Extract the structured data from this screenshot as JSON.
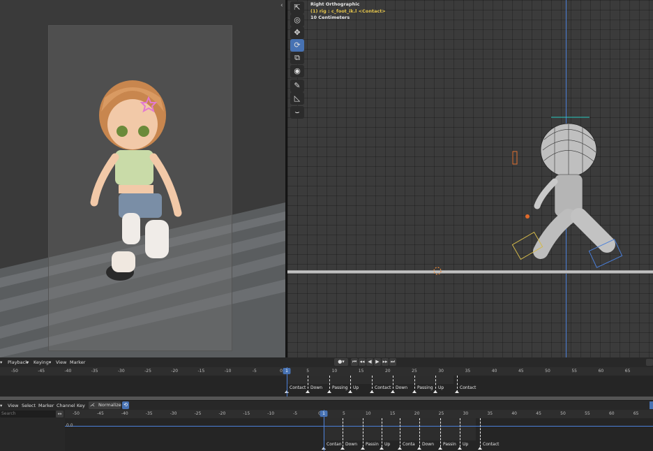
{
  "viewport_right": {
    "view_name": "Right Orthographic",
    "object_line": "(1) rig : c_foot_ik.l <Contact>",
    "scale_text": "10 Centimeters"
  },
  "toolbar": {
    "tools": [
      {
        "name": "select-tool",
        "glyph": "⇱",
        "active": false
      },
      {
        "name": "cursor-tool",
        "glyph": "◎",
        "active": false
      },
      {
        "name": "move-tool",
        "glyph": "✥",
        "active": false
      },
      {
        "name": "rotate-tool",
        "glyph": "⟳",
        "active": true
      },
      {
        "name": "scale-tool",
        "glyph": "⧉",
        "active": false
      },
      {
        "name": "transform-tool",
        "glyph": "◉",
        "active": false
      },
      {
        "name": "annotate-tool",
        "glyph": "✎",
        "active": false
      },
      {
        "name": "measure-tool",
        "glyph": "◺",
        "active": false
      },
      {
        "name": "pose-tool",
        "glyph": "⌣",
        "active": false
      }
    ]
  },
  "timeline": {
    "menu": {
      "playback": "Playback",
      "keying": "Keying",
      "view": "View",
      "marker": "Marker"
    },
    "current_frame": "1",
    "ticks": [
      "-50",
      "-45",
      "-40",
      "-35",
      "-30",
      "-25",
      "-20",
      "-15",
      "-10",
      "-5",
      "0",
      "5",
      "10",
      "15",
      "20",
      "25",
      "30",
      "35",
      "40",
      "45",
      "50",
      "55",
      "60",
      "65"
    ],
    "markers": [
      "Contact",
      "Down",
      "Passing",
      "Up",
      "Contact",
      "Down",
      "Passing",
      "Up",
      "Contact"
    ]
  },
  "graph_editor": {
    "menu": {
      "view": "View",
      "select": "Select",
      "marker": "Marker",
      "channel": "Channel",
      "key": "Key",
      "normalize": "Normalize"
    },
    "search_placeholder": "Search",
    "current_frame": "1",
    "value_label": "0.0",
    "ticks": [
      "-50",
      "-45",
      "-40",
      "-35",
      "-30",
      "-25",
      "-20",
      "-15",
      "-10",
      "-5",
      "0",
      "5",
      "10",
      "15",
      "20",
      "25",
      "30",
      "35",
      "40",
      "45",
      "50",
      "55",
      "60",
      "65"
    ],
    "markers": [
      "Contan",
      "Down",
      "Passin",
      "Up",
      "Conta",
      "Down",
      "Passin",
      "Up",
      "Contact"
    ]
  },
  "colors": {
    "accent": "#4772b3",
    "axis_blue": "#4a7fd9",
    "active_object": "#e6c64d"
  }
}
